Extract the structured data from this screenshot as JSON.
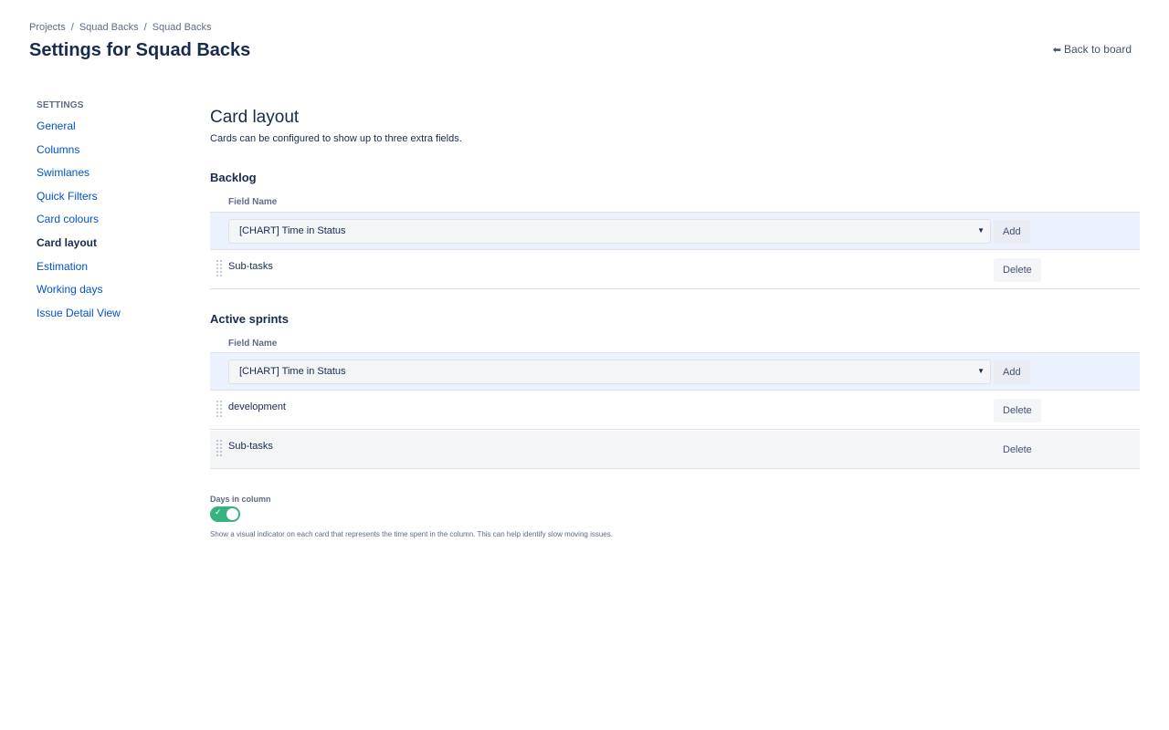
{
  "breadcrumb": [
    "Projects",
    "Squad Backs",
    "Squad Backs"
  ],
  "breadcrumb_separator": "/",
  "page_title": "Settings for Squad Backs",
  "back_link": {
    "icon": "arrow-left-icon",
    "label": "Back to board"
  },
  "sidebar": {
    "heading": "SETTINGS",
    "items": [
      {
        "label": "General",
        "active": false
      },
      {
        "label": "Columns",
        "active": false
      },
      {
        "label": "Swimlanes",
        "active": false
      },
      {
        "label": "Quick Filters",
        "active": false
      },
      {
        "label": "Card colours",
        "active": false
      },
      {
        "label": "Card layout",
        "active": true
      },
      {
        "label": "Estimation",
        "active": false
      },
      {
        "label": "Working days",
        "active": false
      },
      {
        "label": "Issue Detail View",
        "active": false
      }
    ]
  },
  "main": {
    "title": "Card layout",
    "description": "Cards can be configured to show up to three extra fields.",
    "backlog": {
      "title": "Backlog",
      "field_name_header": "Field Name",
      "select_value": "[CHART] Time in Status",
      "add_label": "Add",
      "fields": [
        {
          "name": "Sub-tasks",
          "delete_label": "Delete"
        }
      ]
    },
    "active_sprints": {
      "title": "Active sprints",
      "field_name_header": "Field Name",
      "select_value": "[CHART] Time in Status",
      "add_label": "Add",
      "fields": [
        {
          "name": "development",
          "delete_label": "Delete"
        },
        {
          "name": "Sub-tasks",
          "delete_label": "Delete"
        }
      ]
    },
    "days_in_column": {
      "label": "Days in column",
      "enabled": true,
      "help": "Show a visual indicator on each card that represents the time spent in the column. This can help identify slow moving issues."
    }
  },
  "colors": {
    "accent": "#0052cc",
    "toggle_on": "#36b37e",
    "add_row_bg": "#ebf2fd"
  }
}
